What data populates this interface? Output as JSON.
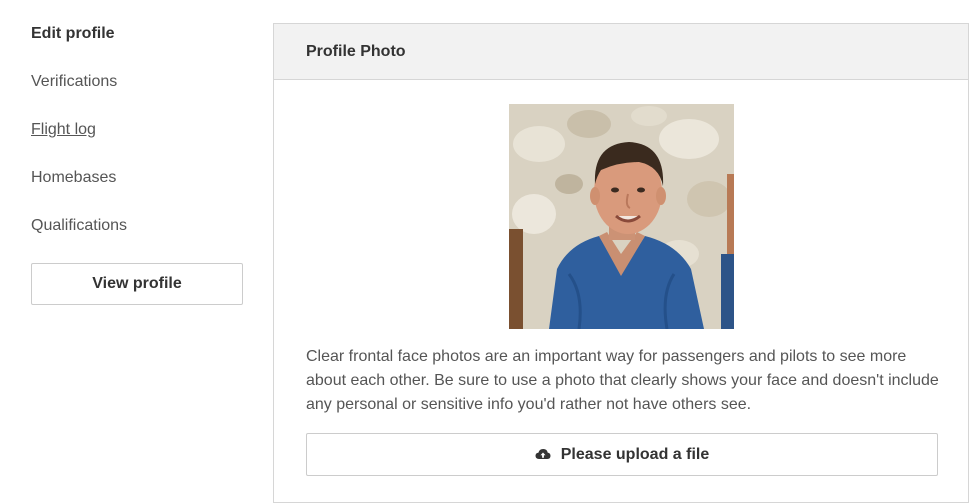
{
  "sidebar": {
    "items": [
      {
        "label": "Edit profile",
        "active": true
      },
      {
        "label": "Verifications",
        "active": false
      },
      {
        "label": "Flight log",
        "active": false,
        "underlined": true
      },
      {
        "label": "Homebases",
        "active": false
      },
      {
        "label": "Qualifications",
        "active": false
      }
    ],
    "view_profile_label": "View profile"
  },
  "panel": {
    "title": "Profile Photo",
    "description": "Clear frontal face photos are an important way for passengers and pilots to see more about each other. Be sure to use a photo that clearly shows your face and doesn't include any personal or sensitive info you'd rather not have others see.",
    "upload_label": "Please upload a file",
    "upload_icon": "cloud-upload-icon"
  },
  "colors": {
    "header_bg": "#f2f2f2",
    "border": "#d6d6d6",
    "text": "#333333",
    "muted_text": "#555555"
  }
}
